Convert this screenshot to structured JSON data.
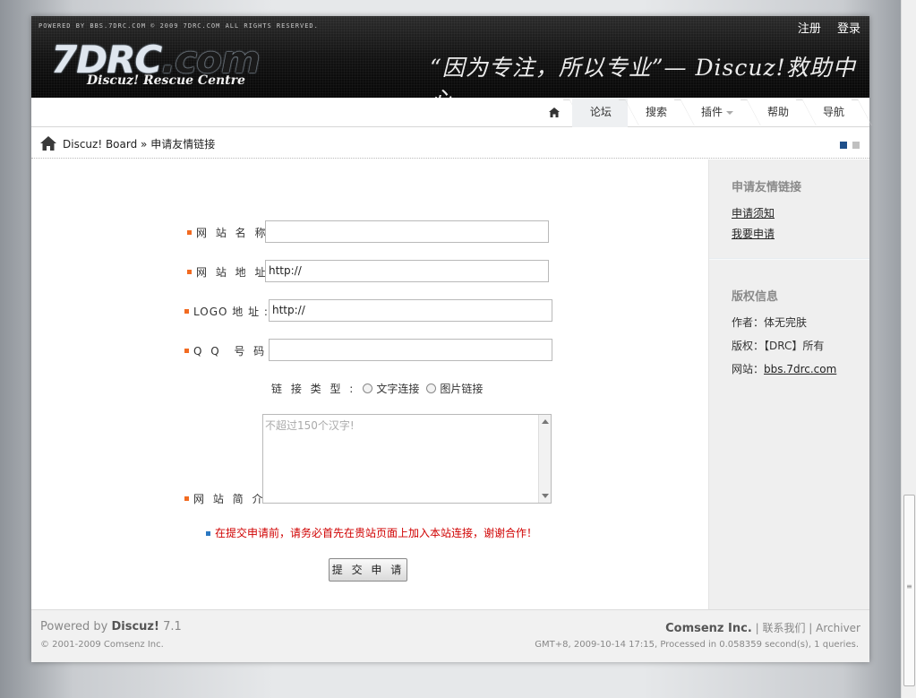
{
  "header": {
    "powered_text": "POWERED BY BBS.7DRC.COM © 2009 7DRC.COM ALL RIGHTS RESERVED.",
    "register": "注册",
    "login": "登录",
    "logo_main": "7DRC",
    "logo_dotcom": ".com",
    "logo_sub": "Discuz! Rescue Centre",
    "slogan": "“因为专注，所以专业”— Discuz!救助中心"
  },
  "nav": {
    "items": [
      {
        "label": "论坛"
      },
      {
        "label": "搜索"
      },
      {
        "label": "插件"
      },
      {
        "label": "帮助"
      },
      {
        "label": "导航"
      }
    ]
  },
  "breadcrumb": {
    "board": "Discuz! Board",
    "sep": " » ",
    "current": "申请友情链接"
  },
  "form": {
    "site_name_label": "网 站 名 称 :",
    "site_name_value": "",
    "site_url_label": "网 站 地 址 :",
    "site_url_value": "http://",
    "logo_url_label": "LOGO 地 址 :",
    "logo_url_value": "http://",
    "qq_label": "Q Q  号 码 :",
    "qq_value": "",
    "link_type_label": "链 接 类 型 :",
    "link_type_text": "文字连接",
    "link_type_image": "图片链接",
    "intro_label": "网 站 简 介 :",
    "intro_placeholder": "不超过150个汉字!",
    "notice": "在提交申请前，请务必首先在贵站页面上加入本站连接，谢谢合作！",
    "submit": "提 交 申 请"
  },
  "sidebar": {
    "apply_title": "申请友情链接",
    "apply_notice": "申请须知",
    "apply_now": "我要申请",
    "copyright_title": "版权信息",
    "author": "作者：体无完肤",
    "rights": "版权：【DRC】所有",
    "site_prefix": "网站：",
    "site_link": "bbs.7drc.com"
  },
  "footer": {
    "powered_prefix": "Powered by ",
    "powered_brand": "Discuz!",
    "powered_version": " 7.1",
    "copyright": "© 2001-2009 Comsenz Inc.",
    "company": "Comsenz Inc.",
    "contact": "联系我们",
    "archiver": "Archiver",
    "stats": "GMT+8, 2009-10-14 17:15, Processed in 0.058359 second(s), 1 queries."
  },
  "colors": {
    "bullet": "#f26b21",
    "notice": "#d00000",
    "view_icon_active": "#1e4f8a",
    "view_icon_inactive": "#c0c0c0"
  }
}
